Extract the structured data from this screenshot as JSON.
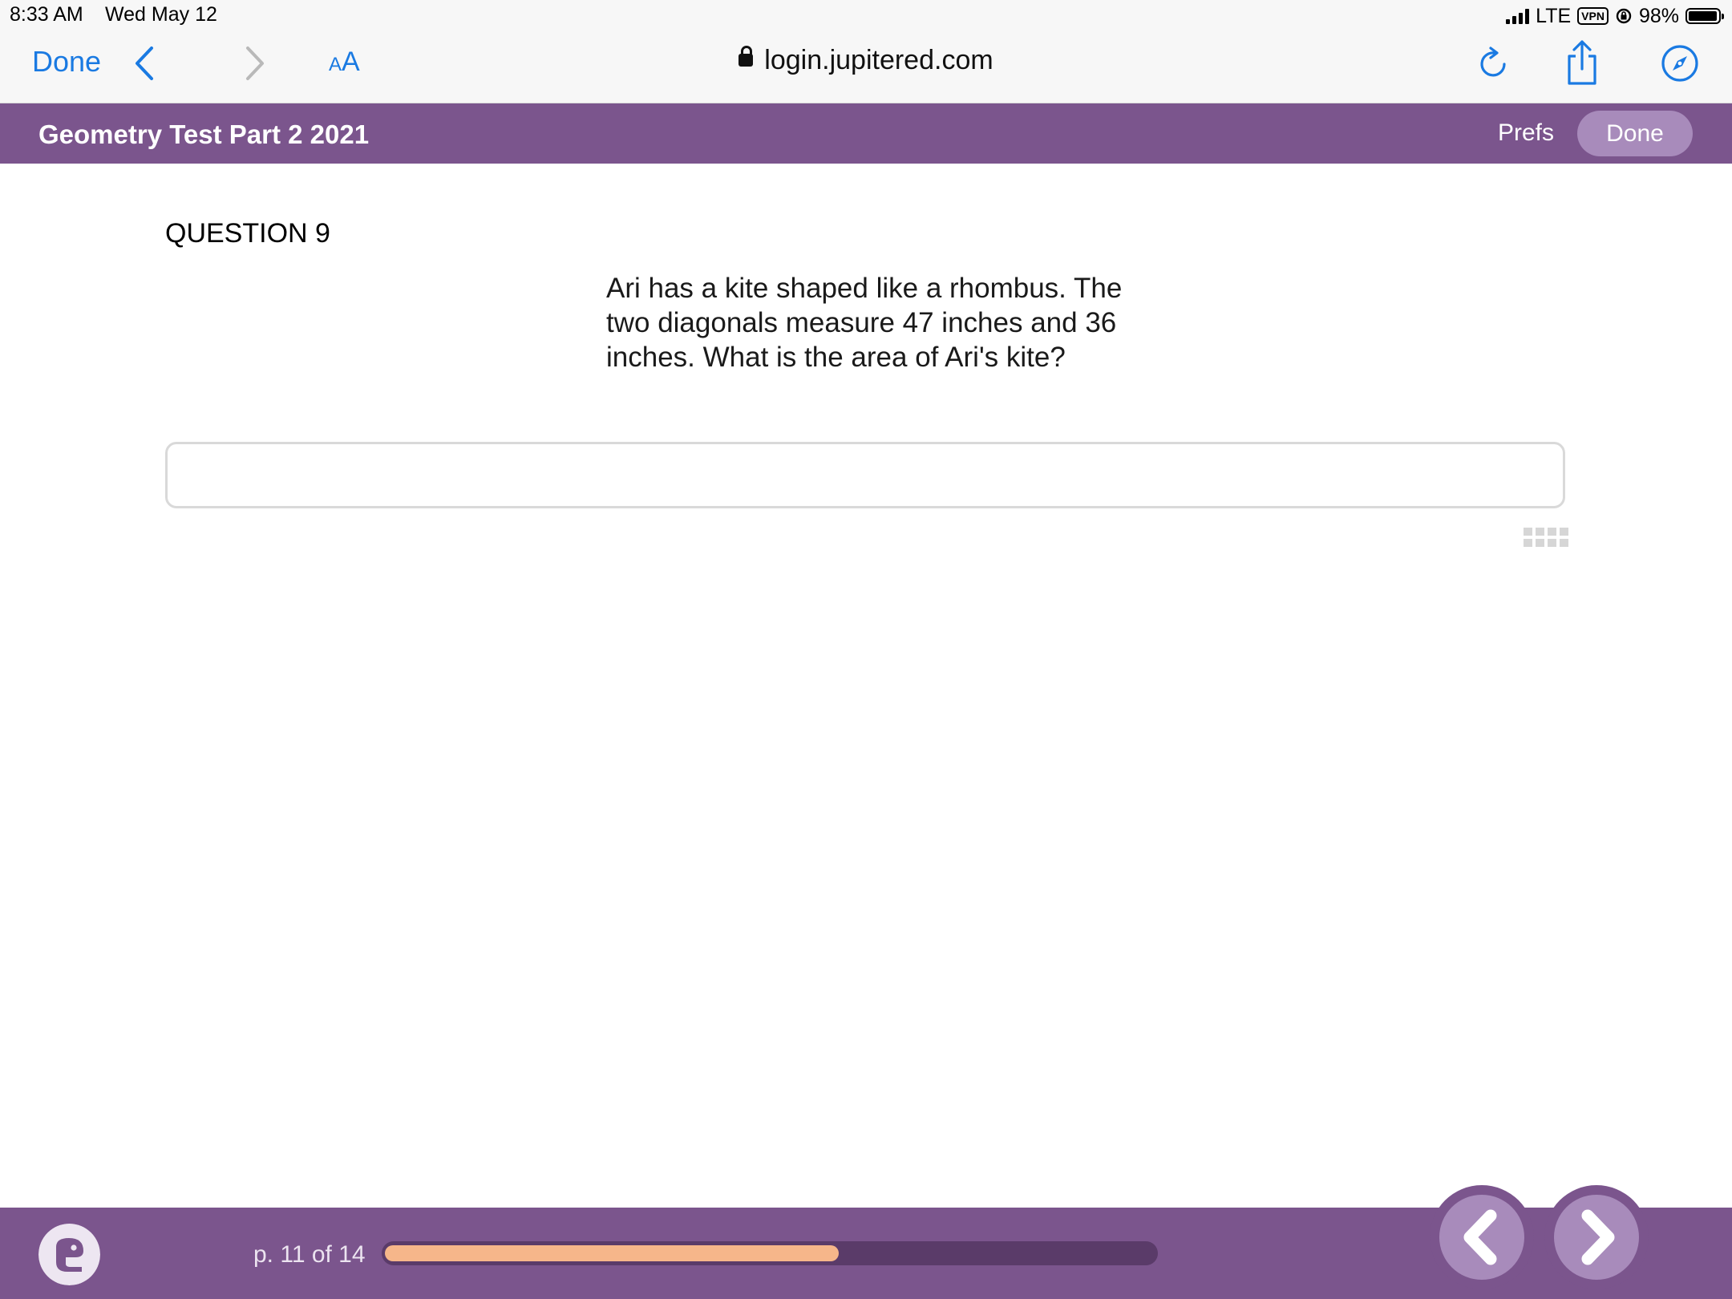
{
  "status_bar": {
    "time": "8:33 AM",
    "date": "Wed May 12",
    "network": "LTE",
    "vpn": "VPN",
    "battery": "98%"
  },
  "browser": {
    "done_label": "Done",
    "text_size_small": "A",
    "text_size_big": "A",
    "url": "login.jupitered.com"
  },
  "app": {
    "title": "Geometry Test Part 2 2021",
    "prefs_label": "Prefs",
    "done_label": "Done",
    "accent_color": "#7b558d"
  },
  "question": {
    "label": "QUESTION 9",
    "text_lines": [
      "Ari has a kite shaped like a rhombus. The",
      "two diagonals measure 47 inches and 36",
      "inches. What is the area of Ari's kite?"
    ],
    "answer_value": "",
    "answer_placeholder": ""
  },
  "footer": {
    "page_label": "p. 11 of 14",
    "progress_fraction": 0.59,
    "progress_color": "#f6b68a"
  }
}
